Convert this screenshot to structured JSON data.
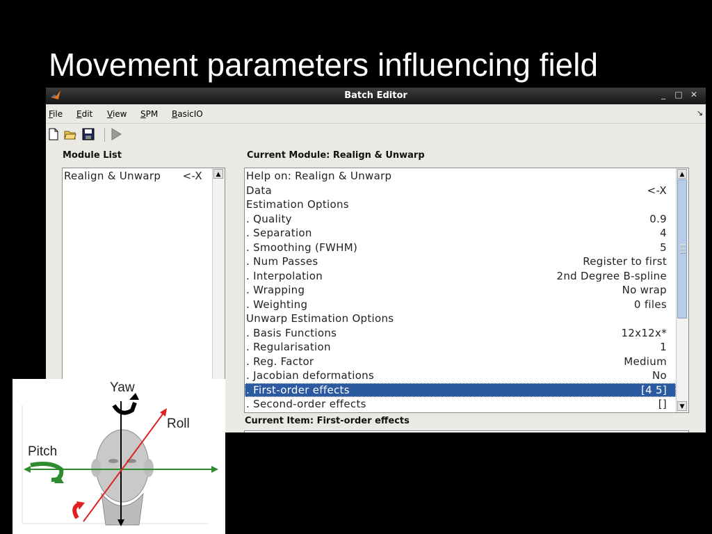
{
  "slide": {
    "title": "Movement parameters influencing field"
  },
  "window": {
    "title": "Batch Editor",
    "controls": {
      "minimize": "_",
      "maximize": "□",
      "close": "✕"
    },
    "menu": [
      {
        "label": "File",
        "mnemonic": "F",
        "rest": "ile"
      },
      {
        "label": "Edit",
        "mnemonic": "E",
        "rest": "dit"
      },
      {
        "label": "View",
        "mnemonic": "V",
        "rest": "iew"
      },
      {
        "label": "SPM",
        "mnemonic": "S",
        "rest": "PM"
      },
      {
        "label": "BasicIO",
        "mnemonic": "B",
        "rest": "asicIO"
      }
    ],
    "menu_arrow": "↘",
    "toolbar": [
      "new-file-icon",
      "open-folder-icon",
      "save-icon",
      "run-icon"
    ]
  },
  "module_list": {
    "heading": "Module List",
    "items": [
      {
        "label": "Realign & Unwarp",
        "value": "<-X"
      }
    ]
  },
  "current_module": {
    "heading": "Current Module: Realign & Unwarp",
    "rows": [
      {
        "label": "Help on: Realign & Unwarp",
        "value": ""
      },
      {
        "label": "Data",
        "value": "<-X"
      },
      {
        "label": "Estimation Options",
        "value": ""
      },
      {
        "label": " . Quality",
        "value": "0.9"
      },
      {
        "label": " . Separation",
        "value": "4"
      },
      {
        "label": " . Smoothing (FWHM)",
        "value": "5"
      },
      {
        "label": " . Num Passes",
        "value": "Register to first"
      },
      {
        "label": " . Interpolation",
        "value": "2nd Degree B-spline"
      },
      {
        "label": " . Wrapping",
        "value": "No wrap"
      },
      {
        "label": " . Weighting",
        "value": "0 files"
      },
      {
        "label": "Unwarp Estimation Options",
        "value": ""
      },
      {
        "label": " . Basis Functions",
        "value": "12x12x*"
      },
      {
        "label": " . Regularisation",
        "value": "1"
      },
      {
        "label": " . Reg. Factor",
        "value": "Medium"
      },
      {
        "label": " . Jacobian deformations",
        "value": "No"
      },
      {
        "label": " . First-order effects",
        "value": "[4 5]",
        "selected": true
      },
      {
        "label": " . Second-order effects",
        "value": "[]"
      }
    ]
  },
  "current_item": {
    "heading": "Current Item: First-order effects"
  },
  "motion_figure": {
    "yaw": "Yaw",
    "roll": "Roll",
    "pitch": "Pitch"
  }
}
